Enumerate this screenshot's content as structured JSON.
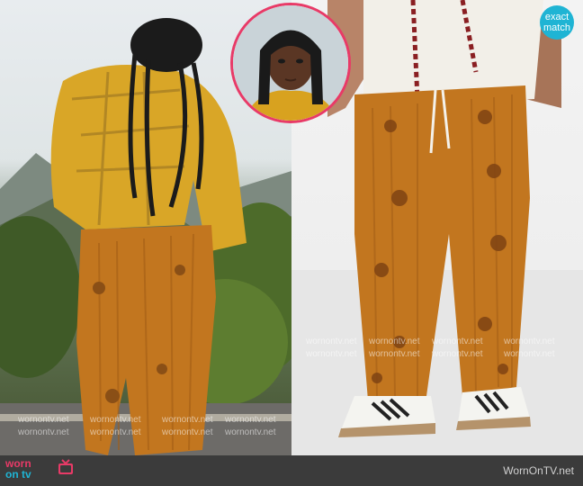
{
  "brand": {
    "line1": "worn",
    "line2": "on tv",
    "tv_label": "TV"
  },
  "footer": {
    "site": "WornOnTV.net"
  },
  "badge": {
    "line1": "exact",
    "line2": "match"
  },
  "watermark": {
    "text": "wornontv.net"
  },
  "colors": {
    "accent_pink": "#e83a67",
    "badge_blue": "#1fb4d4",
    "pants_orange": "#c2761f",
    "footer_bar": "#3b3b3b"
  },
  "icons": [
    "tv-icon"
  ]
}
